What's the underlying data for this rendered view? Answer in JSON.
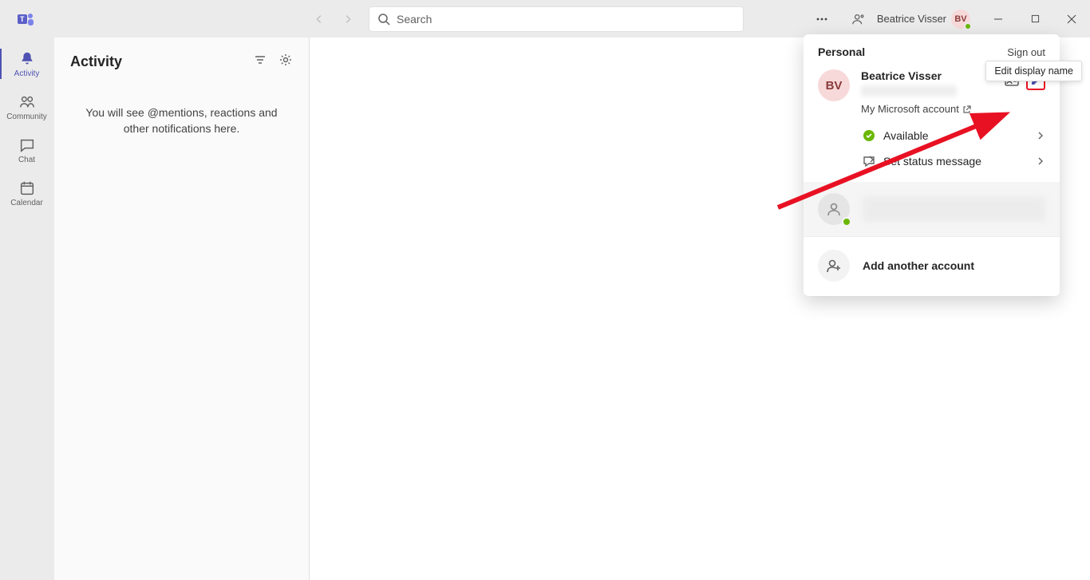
{
  "titlebar": {
    "search_placeholder": "Search",
    "user_name": "Beatrice Visser",
    "user_initials": "BV"
  },
  "leftrail": {
    "items": [
      {
        "label": "Activity"
      },
      {
        "label": "Community"
      },
      {
        "label": "Chat"
      },
      {
        "label": "Calendar"
      }
    ]
  },
  "activity": {
    "title": "Activity",
    "empty_text": "You will see @mentions, reactions and other notifications here."
  },
  "popup": {
    "section_label": "Personal",
    "sign_out": "Sign out",
    "profile_name": "Beatrice Visser",
    "profile_initials": "BV",
    "ms_account": "My Microsoft account",
    "status_available": "Available",
    "set_status_message": "Set status message",
    "add_another": "Add another account"
  },
  "tooltip": {
    "edit_display_name": "Edit display name"
  }
}
